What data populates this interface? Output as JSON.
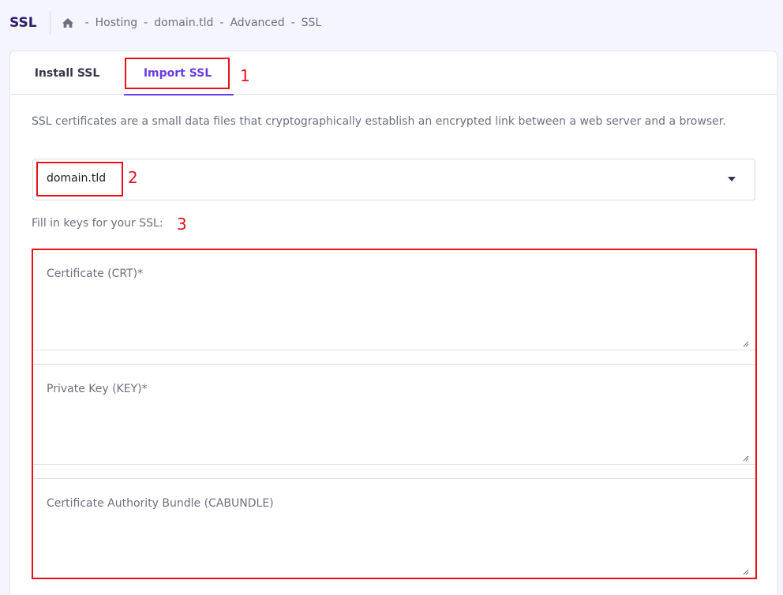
{
  "header": {
    "title": "SSL",
    "breadcrumb": {
      "home_icon": "home-icon",
      "separator": "-",
      "items": [
        "Hosting",
        "domain.tld",
        "Advanced",
        "SSL"
      ]
    }
  },
  "tabs": [
    {
      "label": "Install SSL",
      "active": false
    },
    {
      "label": "Import SSL",
      "active": true
    }
  ],
  "annotations": [
    "1",
    "2",
    "3"
  ],
  "description": "SSL certificates are a small data files that cryptographically establish an encrypted link between a web server and a browser.",
  "domain_select": {
    "value": "domain.tld",
    "icon": "caret-down-icon"
  },
  "fill_label": "Fill in keys for your SSL:",
  "fields": [
    {
      "label": "Certificate (CRT)*",
      "value": ""
    },
    {
      "label": "Private Key (KEY)*",
      "value": ""
    },
    {
      "label": "Certificate Authority Bundle (CABUNDLE)",
      "value": ""
    }
  ],
  "colors": {
    "accent": "#673de6",
    "annotation_red": "#e8101a",
    "title": "#2f1c6a"
  }
}
